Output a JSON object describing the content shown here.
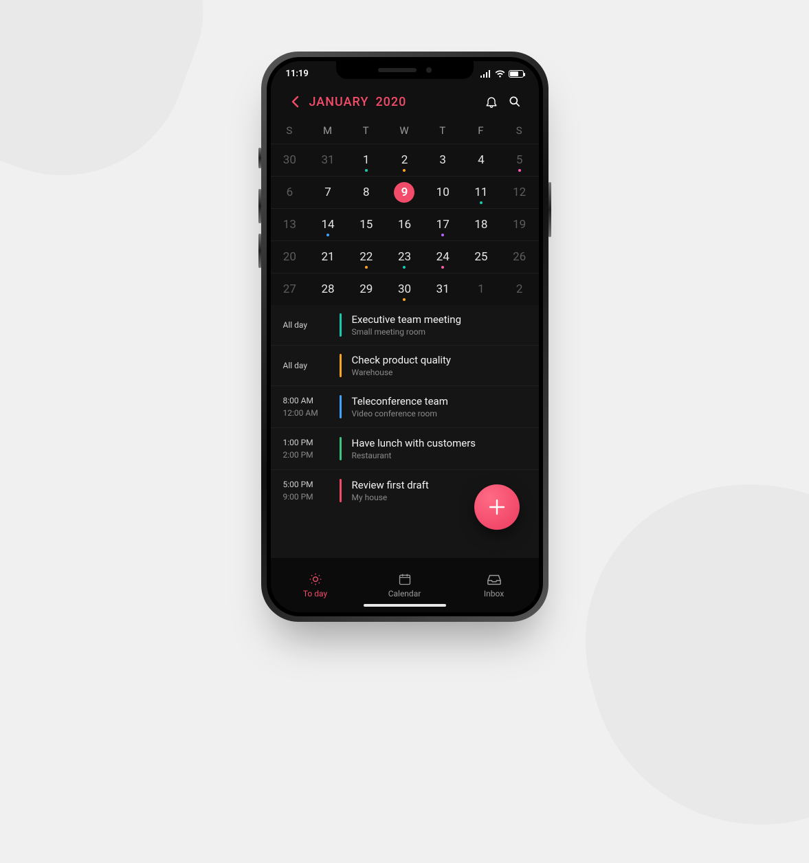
{
  "status": {
    "time": "11:19"
  },
  "header": {
    "month": "JANUARY",
    "year": "2020"
  },
  "weekdays": [
    "S",
    "M",
    "T",
    "W",
    "T",
    "F",
    "S"
  ],
  "calendar": {
    "weeks": [
      [
        {
          "n": "30",
          "dim": true
        },
        {
          "n": "31",
          "dim": true
        },
        {
          "n": "1",
          "dot": "teal"
        },
        {
          "n": "2",
          "dot": "orange"
        },
        {
          "n": "3"
        },
        {
          "n": "4"
        },
        {
          "n": "5",
          "dim": true,
          "dot": "pink"
        }
      ],
      [
        {
          "n": "6",
          "dim": true
        },
        {
          "n": "7"
        },
        {
          "n": "8"
        },
        {
          "n": "9",
          "selected": true
        },
        {
          "n": "10"
        },
        {
          "n": "11",
          "dot": "teal"
        },
        {
          "n": "12",
          "dim": true
        }
      ],
      [
        {
          "n": "13",
          "dim": true
        },
        {
          "n": "14",
          "dot": "blue"
        },
        {
          "n": "15"
        },
        {
          "n": "16"
        },
        {
          "n": "17",
          "dot": "purple"
        },
        {
          "n": "18"
        },
        {
          "n": "19",
          "dim": true
        }
      ],
      [
        {
          "n": "20",
          "dim": true
        },
        {
          "n": "21"
        },
        {
          "n": "22",
          "dot": "orange"
        },
        {
          "n": "23",
          "dot": "teal"
        },
        {
          "n": "24",
          "dot": "pink"
        },
        {
          "n": "25"
        },
        {
          "n": "26",
          "dim": true
        }
      ],
      [
        {
          "n": "27",
          "dim": true
        },
        {
          "n": "28"
        },
        {
          "n": "29"
        },
        {
          "n": "30",
          "dot": "orange"
        },
        {
          "n": "31"
        },
        {
          "n": "1",
          "dim": true
        },
        {
          "n": "2",
          "dim": true
        }
      ]
    ]
  },
  "events": [
    {
      "time": "All day",
      "end": "",
      "title": "Executive team meeting",
      "loc": "Small meeting room",
      "color": "teal"
    },
    {
      "time": "All day",
      "end": "",
      "title": "Check product quality",
      "loc": "Warehouse",
      "color": "orange"
    },
    {
      "time": "8:00 AM",
      "end": "12:00 AM",
      "title": "Teleconference team",
      "loc": "Video conference room",
      "color": "blue"
    },
    {
      "time": "1:00 PM",
      "end": "2:00 PM",
      "title": "Have lunch with customers",
      "loc": "Restaurant",
      "color": "green"
    },
    {
      "time": "5:00 PM",
      "end": "9:00 PM",
      "title": "Review first draft",
      "loc": "My house",
      "color": "pink"
    }
  ],
  "nav": {
    "today": "To day",
    "calendar": "Calendar",
    "inbox": "Inbox"
  }
}
